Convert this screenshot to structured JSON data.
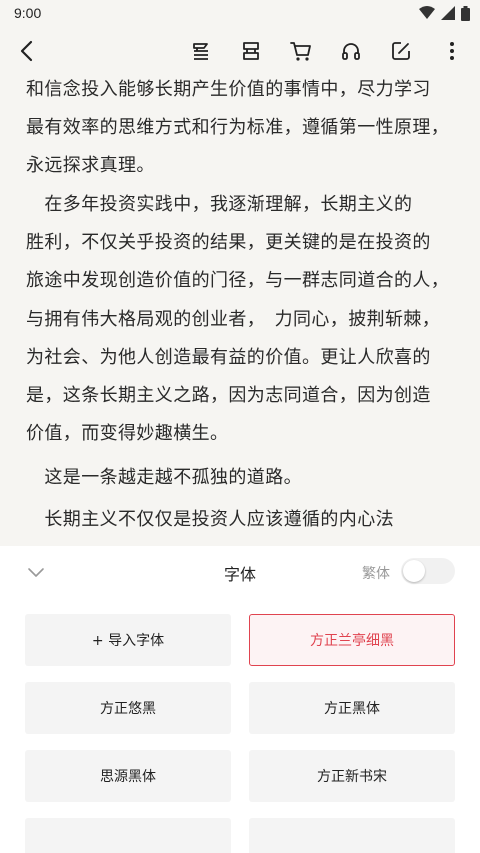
{
  "status_bar": {
    "time": "9:00"
  },
  "reader": {
    "lines": [
      "和信念投入能够长期产生价值的事情中，尽力学习",
      "最有效率的思维方式和行为标准，遵循第一性原理，",
      "永远探求真理。",
      "　在多年投资实践中，我逐渐理解，长期主义的",
      "胜利，不仅关乎投资的结果，更关键的是在投资的",
      "旅途中发现创造价值的门径，与一群志同道合的人，",
      "与拥有伟大格局观的创业者，　力同心，披荆斩棘，",
      "为社会、为他人创造最有益的价值。更让人欣喜的",
      "是，这条长期主义之路，因为志同道合，因为创造",
      "价值，而变得妙趣横生。",
      "　这是一条越走越不孤独的道路。",
      "　长期主义不仅仅是投资人应该遵循的内心法"
    ]
  },
  "font_panel": {
    "title": "字体",
    "traditional_label": "繁体",
    "traditional_enabled": false,
    "accent_color": "#e0434f",
    "fonts": [
      {
        "label": "+ 导入字体",
        "selected": false
      },
      {
        "label": "方正兰亭细黑",
        "selected": true
      },
      {
        "label": "方正悠黑",
        "selected": false
      },
      {
        "label": "方正黑体",
        "selected": false
      },
      {
        "label": "思源黑体",
        "selected": false
      },
      {
        "label": "方正新书宋",
        "selected": false
      },
      {
        "label": "",
        "selected": false
      },
      {
        "label": "",
        "selected": false
      }
    ]
  }
}
